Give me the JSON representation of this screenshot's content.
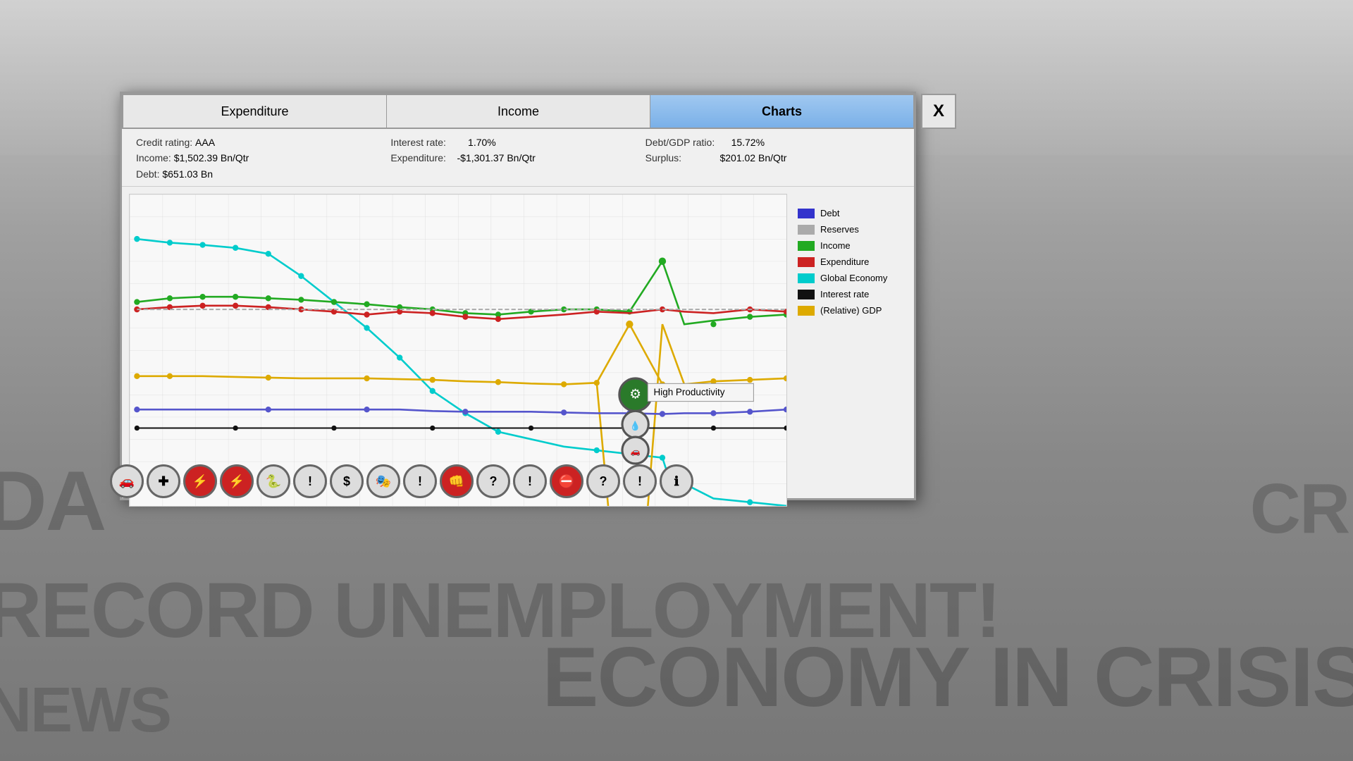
{
  "background": {
    "newspaper_lines": [
      "DA",
      "RECORD UNEMPLOYMENT!",
      "NEWS",
      "CRI",
      "ECONOMY IN CRISIS"
    ]
  },
  "dialog": {
    "tabs": [
      {
        "label": "Expenditure",
        "active": false
      },
      {
        "label": "Income",
        "active": false
      },
      {
        "label": "Charts",
        "active": true
      }
    ],
    "close_label": "X",
    "stats": {
      "credit_rating_label": "Credit rating:",
      "credit_rating_value": "AAA",
      "income_label": "Income:",
      "income_value": "$1,502.39 Bn/Qtr",
      "debt_label": "Debt:",
      "debt_value": "$651.03 Bn",
      "interest_rate_label": "Interest rate:",
      "interest_rate_value": "1.70%",
      "expenditure_label": "Expenditure:",
      "expenditure_value": "-$1,301.37 Bn/Qtr",
      "debt_gdp_label": "Debt/GDP ratio:",
      "debt_gdp_value": "15.72%",
      "surplus_label": "Surplus:",
      "surplus_value": "$201.02 Bn/Qtr"
    },
    "legend": [
      {
        "label": "Debt",
        "color": "#3333cc"
      },
      {
        "label": "Reserves",
        "color": "#aaaaaa"
      },
      {
        "label": "Income",
        "color": "#22aa22"
      },
      {
        "label": "Expenditure",
        "color": "#cc2222"
      },
      {
        "label": "Global Economy",
        "color": "#00cccc"
      },
      {
        "label": "Interest rate",
        "color": "#111111"
      },
      {
        "label": "(Relative) GDP",
        "color": "#ddaa00"
      }
    ],
    "tooltip": {
      "text": "High Productivity"
    },
    "event_icons": [
      {
        "symbol": "🚗",
        "type": "normal"
      },
      {
        "symbol": "✚",
        "type": "normal"
      },
      {
        "symbol": "⚡",
        "type": "red"
      },
      {
        "symbol": "⚡",
        "type": "red"
      },
      {
        "symbol": "🐍",
        "type": "normal"
      },
      {
        "symbol": "!",
        "type": "normal"
      },
      {
        "symbol": "$",
        "type": "normal"
      },
      {
        "symbol": "🎭",
        "type": "normal"
      },
      {
        "symbol": "!",
        "type": "normal"
      },
      {
        "symbol": "👊",
        "type": "red"
      },
      {
        "symbol": "?",
        "type": "normal"
      },
      {
        "symbol": "!",
        "type": "normal"
      },
      {
        "symbol": "⛔",
        "type": "red"
      },
      {
        "symbol": "?",
        "type": "normal"
      },
      {
        "symbol": "!",
        "type": "normal"
      },
      {
        "symbol": "ℹ",
        "type": "normal"
      }
    ]
  }
}
